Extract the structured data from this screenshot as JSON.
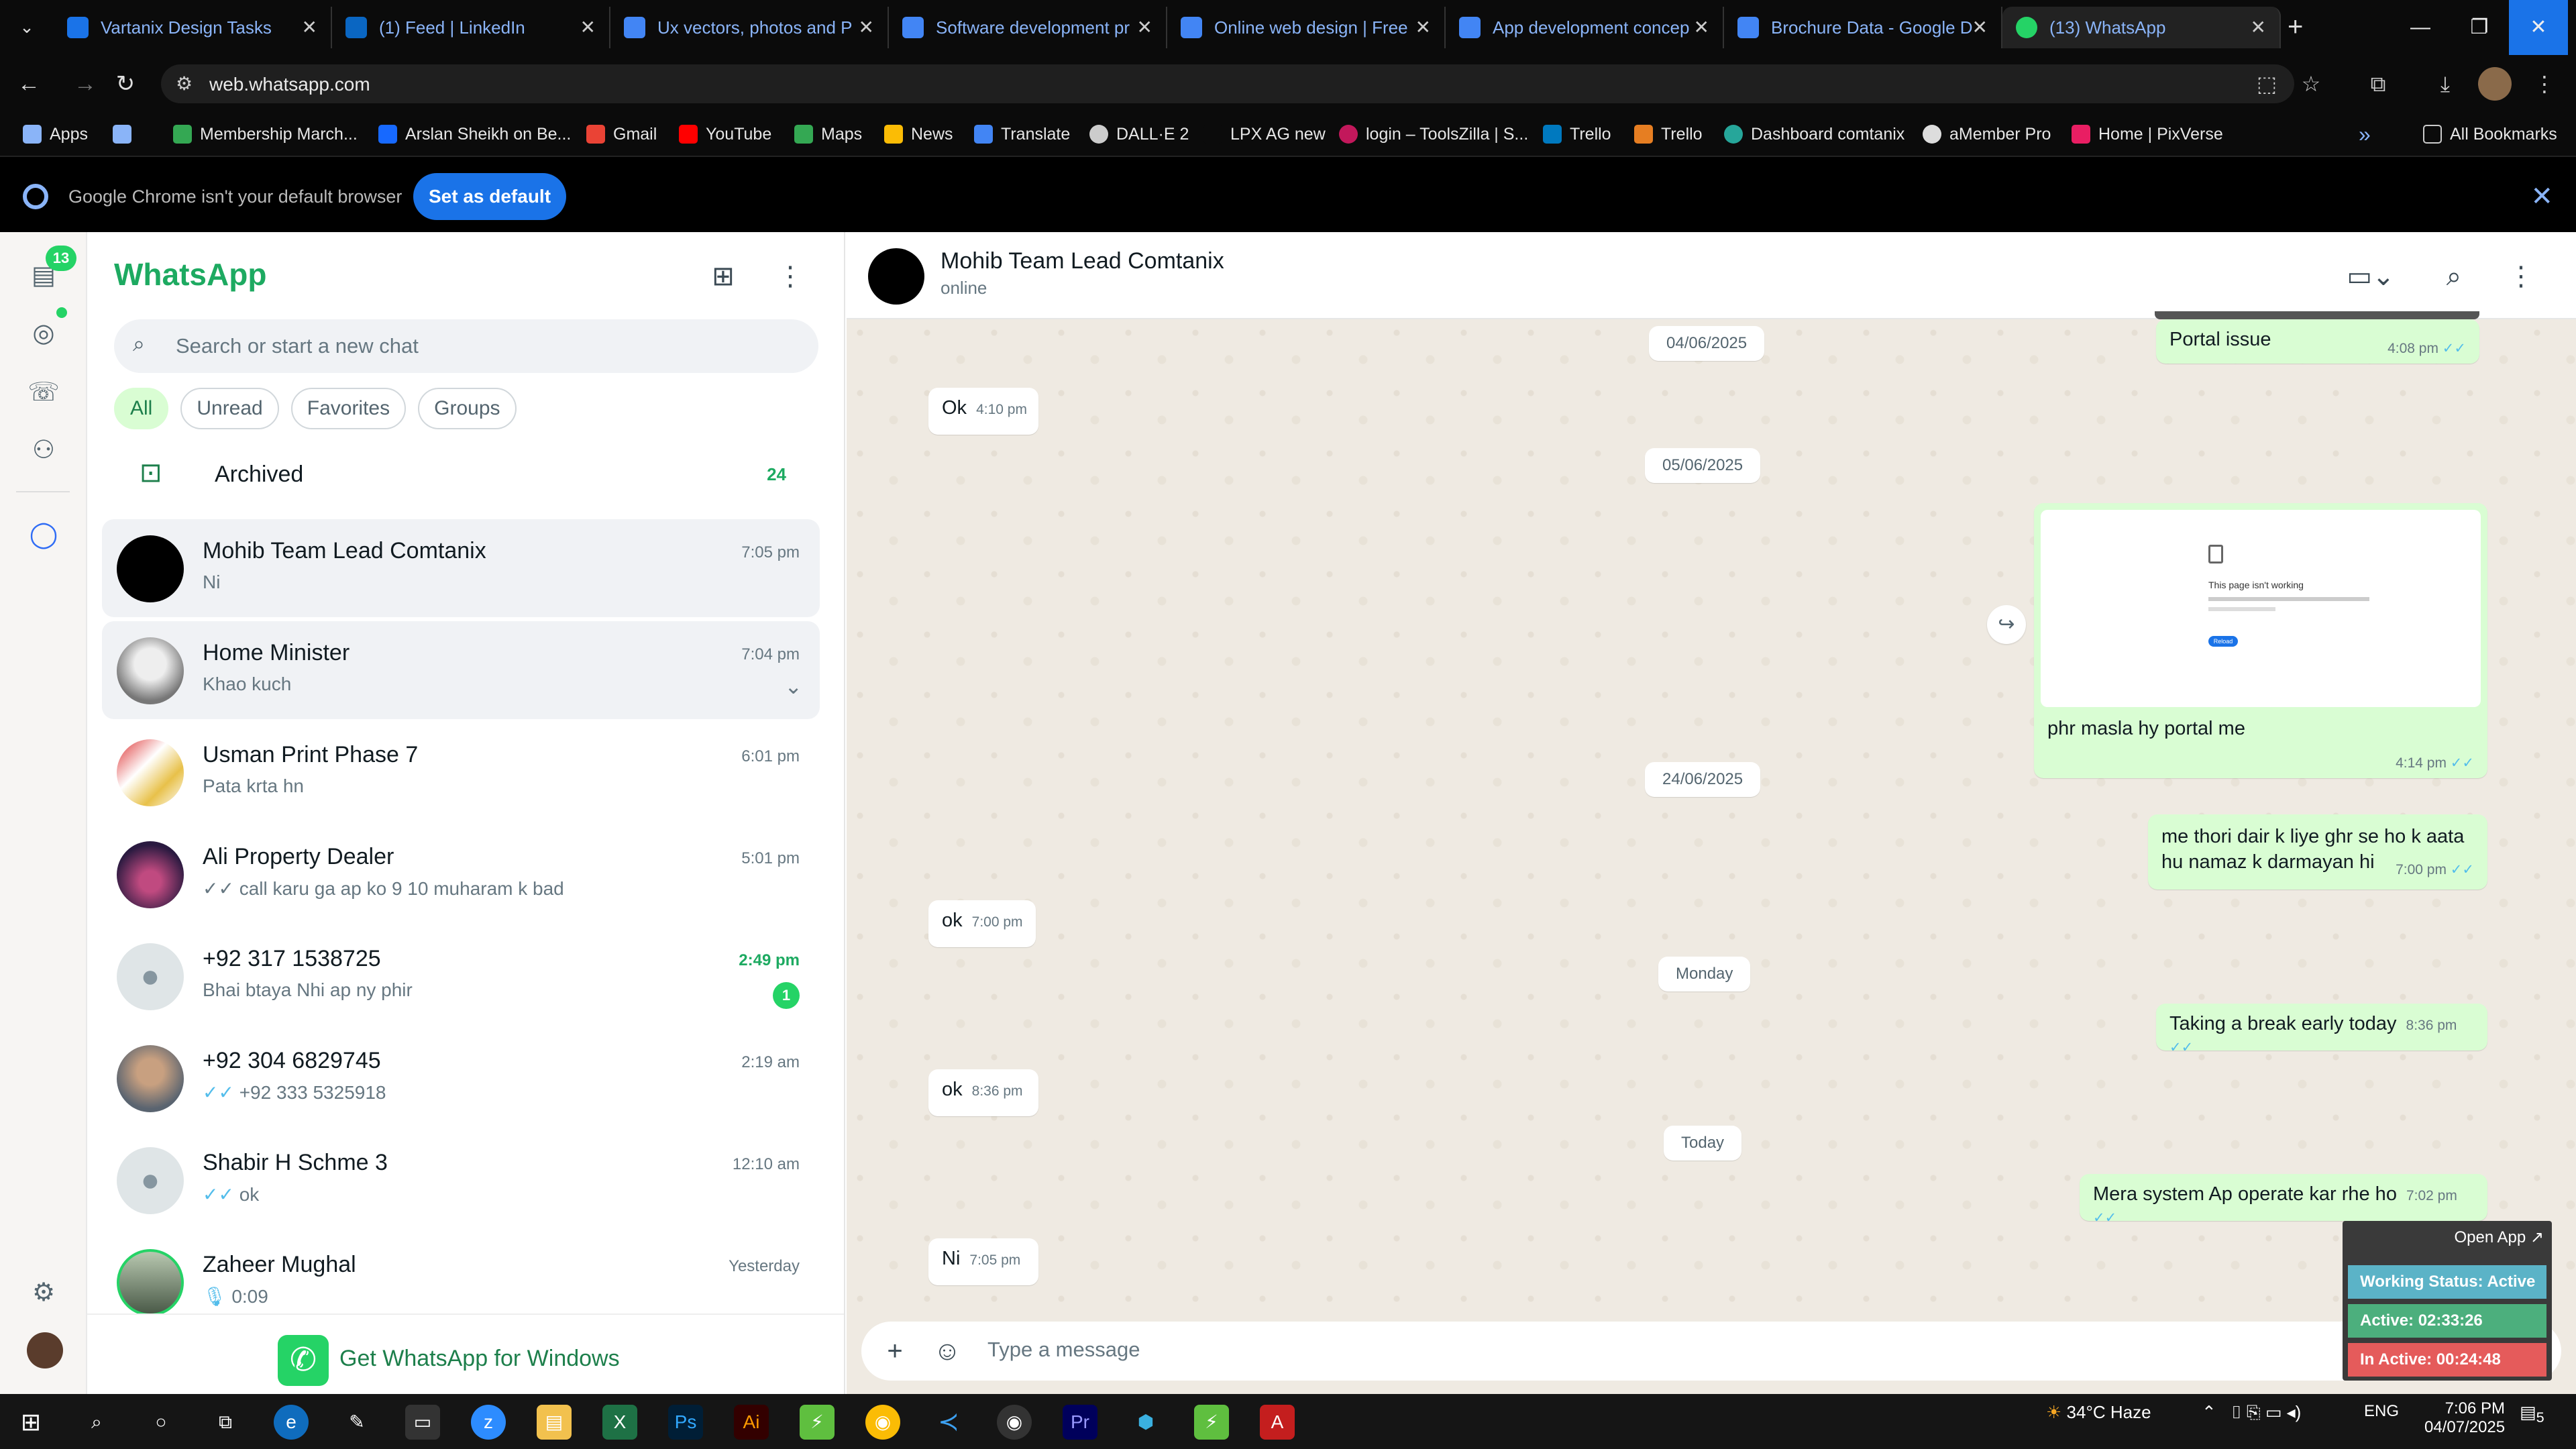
{
  "browser": {
    "tabs": [
      {
        "title": "Vartanix Design Tasks",
        "color": "#1a73e8"
      },
      {
        "title": "(1) Feed | LinkedIn",
        "color": "#0a66c2"
      },
      {
        "title": "Ux vectors, photos and P",
        "color": "#4285f4"
      },
      {
        "title": "Software development pr",
        "color": "#4285f4"
      },
      {
        "title": "Online web design | Free",
        "color": "#4285f4"
      },
      {
        "title": "App development concep",
        "color": "#4285f4"
      },
      {
        "title": "Brochure Data - Google D",
        "color": "#4285f4"
      },
      {
        "title": "(13) WhatsApp",
        "color": "#25d366"
      }
    ],
    "url": "web.whatsapp.com",
    "bookmarks": [
      {
        "label": "Apps",
        "color": "#8ab4f8"
      },
      {
        "label": "",
        "color": "#8ab4f8"
      },
      {
        "label": "Membership March...",
        "color": "#34a853"
      },
      {
        "label": "Arslan Sheikh on Be...",
        "color": "#1769ff"
      },
      {
        "label": "Gmail",
        "color": "#ea4335"
      },
      {
        "label": "YouTube",
        "color": "#ff0000"
      },
      {
        "label": "Maps",
        "color": "#34a853"
      },
      {
        "label": "News",
        "color": "#fbbc05"
      },
      {
        "label": "Translate",
        "color": "#4285f4"
      },
      {
        "label": "DALL·E 2",
        "color": "#cccccc"
      },
      {
        "label": "LPX AG new",
        "color": "#0b0b0b"
      },
      {
        "label": "login – ToolsZilla | S...",
        "color": "#c2185b"
      },
      {
        "label": "Trello",
        "color": "#0079bf"
      },
      {
        "label": "Trello",
        "color": "#e67e22"
      },
      {
        "label": "Dashboard comtanix",
        "color": "#26a69a"
      },
      {
        "label": "aMember Pro",
        "color": "#dddddd"
      },
      {
        "label": "Home | PixVerse",
        "color": "#e91e63"
      }
    ],
    "all_bookmarks": "All Bookmarks",
    "banner_text": "Google Chrome isn't your default browser",
    "banner_button": "Set as default"
  },
  "whatsapp": {
    "rail_badge": "13",
    "title": "WhatsApp",
    "search_placeholder": "Search or start a new chat",
    "filters": [
      "All",
      "Unread",
      "Favorites",
      "Groups"
    ],
    "archived_label": "Archived",
    "archived_count": "24",
    "chats": [
      {
        "name": "Mohib Team Lead Comtanix",
        "msg": "Ni",
        "time": "7:05 pm",
        "ticks": false
      },
      {
        "name": "Home Minister",
        "msg": "Khao kuch",
        "time": "7:04 pm",
        "ticks": false
      },
      {
        "name": "Usman Print Phase 7",
        "msg": "Pata krta hn",
        "time": "6:01 pm",
        "ticks": false
      },
      {
        "name": "Ali Property Dealer",
        "msg": "call karu ga ap ko 9 10 muharam k bad",
        "time": "5:01 pm",
        "ticks": true
      },
      {
        "name": "+92 317 1538725",
        "msg": "Bhai btaya Nhi ap ny phir",
        "time": "2:49 pm",
        "ticks": false,
        "unread": "1"
      },
      {
        "name": "+92 304 6829745",
        "msg": "+92 333 5325918",
        "time": "2:19 am",
        "ticks": true
      },
      {
        "name": "Shabir H  Schme 3",
        "msg": "ok",
        "time": "12:10 am",
        "ticks": true
      },
      {
        "name": "Zaheer Mughal",
        "msg": "0:09",
        "time": "Yesterday",
        "ticks": false
      }
    ],
    "get_windows": "Get WhatsApp for Windows",
    "contact_name": "Mohib Team Lead Comtanix",
    "contact_status": "online",
    "dates": [
      "04/06/2025",
      "05/06/2025",
      "24/06/2025",
      "Monday",
      "Today"
    ],
    "messages": [
      {
        "dir": "out",
        "text": "Portal issue",
        "time": "4:08 pm"
      },
      {
        "dir": "in",
        "text": "Ok",
        "time": "4:10 pm"
      },
      {
        "dir": "out",
        "text": "phr masla hy portal me",
        "time": "4:14 pm"
      },
      {
        "dir": "out",
        "text": "me thori dair k liye ghr se ho k aata hu namaz k darmayan hi",
        "time": "7:00 pm"
      },
      {
        "dir": "in",
        "text": "ok",
        "time": "7:00 pm"
      },
      {
        "dir": "out",
        "text": "Taking a break early today",
        "time": "8:36 pm"
      },
      {
        "dir": "in",
        "text": "ok",
        "time": "8:36 pm"
      },
      {
        "dir": "out",
        "text": "Mera system Ap operate kar rhe ho",
        "time": "7:02 pm"
      },
      {
        "dir": "in",
        "text": "Ni",
        "time": "7:05 pm"
      }
    ],
    "preview_title": "This page isn't working",
    "preview_button": "Reload",
    "composer_placeholder": "Type a message"
  },
  "widget": {
    "open_app": "Open App ↗",
    "status": "Working Status: Active",
    "active": "Active: 02:33:26",
    "inactive": "In Active: 00:24:48",
    "status_color": "#5bb3c7",
    "active_color": "#4caf7d",
    "inactive_color": "#e55b5b"
  },
  "taskbar": {
    "weather": "34°C  Haze",
    "lang": "ENG",
    "time": "7:06 PM",
    "date": "04/07/2025",
    "notif": "5"
  }
}
